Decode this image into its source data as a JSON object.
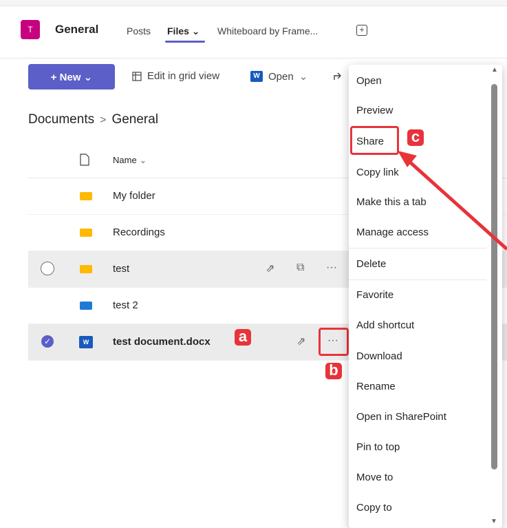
{
  "header": {
    "avatar_letter": "T",
    "channel_name": "General",
    "tabs": [
      {
        "label": "Posts"
      },
      {
        "label": "Files ⌄"
      },
      {
        "label": "Whiteboard by Frame..."
      }
    ],
    "add_tab_symbol": "+"
  },
  "toolbar": {
    "new_label": "+ New ⌄",
    "edit_grid_label": "Edit in grid view",
    "open_label": "Open",
    "open_chevron": "⌄",
    "word_letter": "W"
  },
  "breadcrumb": {
    "root": "Documents",
    "separator": ">",
    "current": "General"
  },
  "list": {
    "name_header": "Name",
    "name_header_chevron": "⌄",
    "rows": [
      {
        "name": "My folder"
      },
      {
        "name": "Recordings"
      },
      {
        "name": "test"
      },
      {
        "name": "test 2"
      },
      {
        "name": "test document.docx"
      }
    ],
    "more_symbol": "···"
  },
  "annotations": {
    "a": "a",
    "b": "b",
    "c": "c"
  },
  "menu": {
    "items": [
      "Open",
      "Preview",
      "Share",
      "Copy link",
      "Make this a tab",
      "Manage access",
      "Delete",
      "Favorite",
      "Add shortcut",
      "Download",
      "Rename",
      "Open in SharePoint",
      "Pin to top",
      "Move to",
      "Copy to"
    ]
  },
  "colors": {
    "accent": "#5b5fc7",
    "avatar": "#c7027f",
    "annotation": "#e8333a",
    "folder": "#ffb900"
  }
}
